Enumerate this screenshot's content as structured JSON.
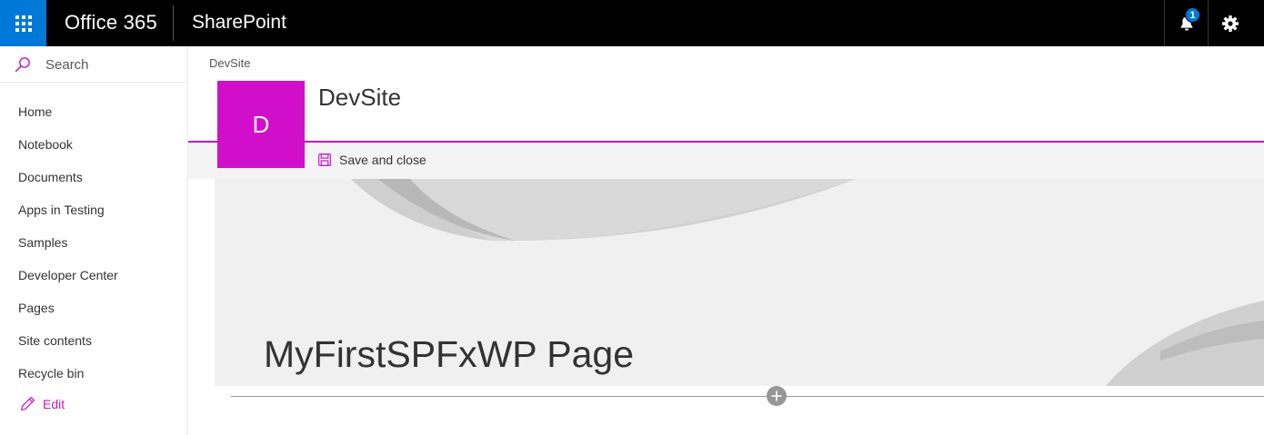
{
  "suite_bar": {
    "brand": "Office 365",
    "app_name": "SharePoint",
    "notification_count": "1",
    "icons": [
      "app-launcher-icon",
      "bell-icon",
      "gear-icon"
    ]
  },
  "nav": {
    "search_placeholder": "Search",
    "items": [
      {
        "label": "Home"
      },
      {
        "label": "Notebook"
      },
      {
        "label": "Documents"
      },
      {
        "label": "Apps in Testing"
      },
      {
        "label": "Samples"
      },
      {
        "label": "Developer Center"
      },
      {
        "label": "Pages"
      },
      {
        "label": "Site contents"
      },
      {
        "label": "Recycle bin"
      }
    ],
    "edit_label": "Edit"
  },
  "site": {
    "breadcrumb": "DevSite",
    "logo_letter": "D",
    "title": "DevSite"
  },
  "command_bar": {
    "save_close_label": "Save and close"
  },
  "page": {
    "title": "MyFirstSPFxWP Page"
  },
  "colors": {
    "suite_bar": "#000000",
    "waffle": "#0078d7",
    "accent": "#c516c5",
    "site_logo": "#d10fcb"
  }
}
